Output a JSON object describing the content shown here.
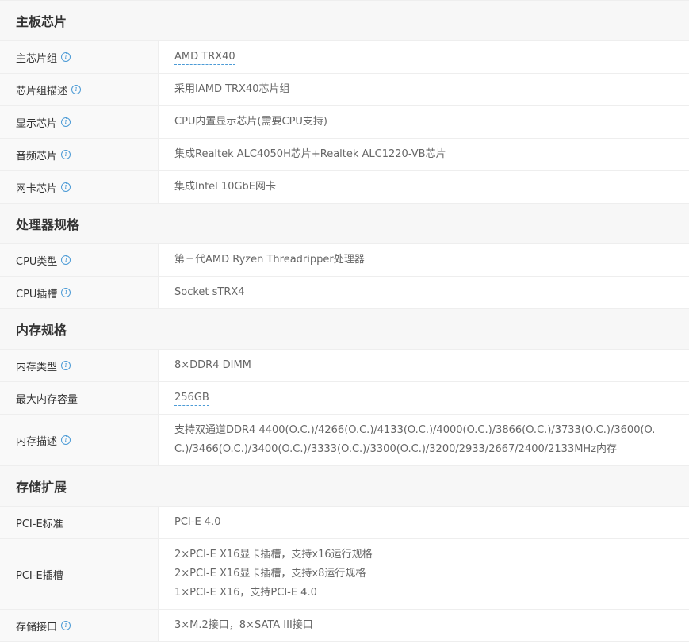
{
  "sections": [
    {
      "title": "主板芯片",
      "rows": [
        {
          "label": "主芯片组",
          "value": "AMD TRX40"
        },
        {
          "label": "芯片组描述",
          "value": "采用IAMD TRX40芯片组"
        },
        {
          "label": "显示芯片",
          "value": "CPU内置显示芯片(需要CPU支持)"
        },
        {
          "label": "音频芯片",
          "value": "集成Realtek ALC4050H芯片+Realtek ALC1220-VB芯片"
        },
        {
          "label": "网卡芯片",
          "value": "集成Intel 10GbE网卡"
        }
      ]
    },
    {
      "title": "处理器规格",
      "rows": [
        {
          "label": "CPU类型",
          "value": "第三代AMD Ryzen Threadripper处理器"
        },
        {
          "label": "CPU插槽",
          "value": "Socket sTRX4"
        }
      ]
    },
    {
      "title": "内存规格",
      "rows": [
        {
          "label": "内存类型",
          "value": "8×DDR4 DIMM"
        },
        {
          "label": "最大内存容量",
          "value": "256GB"
        },
        {
          "label": "内存描述",
          "value_lines": [
            "支持双通道DDR4 4400(O.C.)/4266(O.C.)/4133(O.C.)/4000(O.C.)/3866(O.C.)/3733(O.C.)/3600(O.",
            "C.)/3466(O.C.)/3400(O.C.)/3333(O.C.)/3300(O.C.)/3200/2933/2667/2400/2133MHz内存"
          ]
        }
      ]
    },
    {
      "title": "存储扩展",
      "rows": [
        {
          "label": "PCI-E标准",
          "value": "PCI-E 4.0"
        },
        {
          "label": "PCI-E插槽",
          "value_lines": [
            "2×PCI-E X16显卡插槽，支持x16运行规格",
            "2×PCI-E X16显卡插槽，支持x8运行规格",
            "1×PCI-E X16，支持PCI-E 4.0"
          ]
        },
        {
          "label": "存储接口",
          "value": "3×M.2接口，8×SATA III接口"
        }
      ]
    }
  ],
  "info_icon_glyph": "i",
  "colors": {
    "accent": "#4c9bd6",
    "header_bg": "#f7f7f7",
    "label_bg": "#f9f9f9",
    "border": "#eeeeee"
  }
}
